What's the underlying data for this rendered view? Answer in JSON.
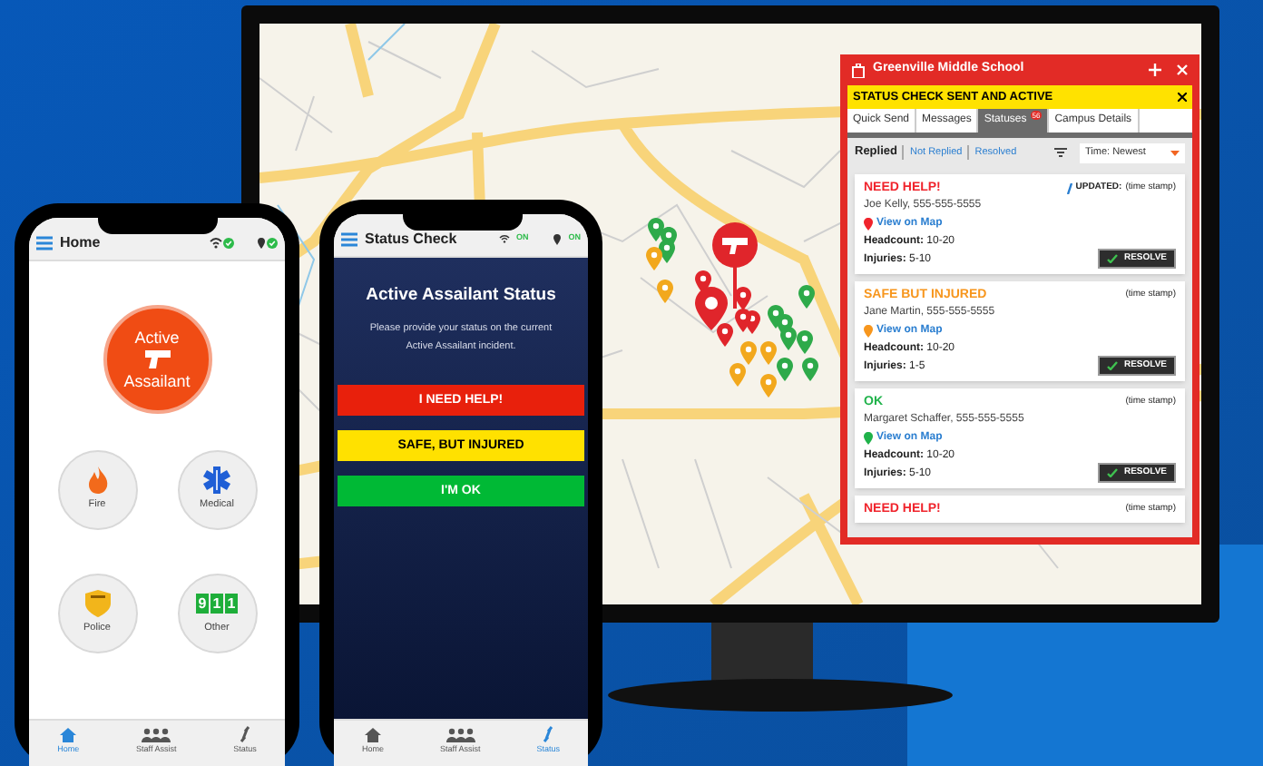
{
  "map": {
    "pins": [
      {
        "color": "#2eaa4a"
      },
      {
        "color": "#2eaa4a"
      },
      {
        "color": "#2eaa4a"
      },
      {
        "color": "#f2a81d"
      },
      {
        "color": "#f2a81d"
      },
      {
        "color": "#e0252b"
      },
      {
        "color": "#e0252b"
      },
      {
        "color": "#e0252b"
      },
      {
        "color": "#e0252b"
      },
      {
        "color": "#e0252b"
      },
      {
        "color": "#2eaa4a"
      },
      {
        "color": "#2eaa4a"
      },
      {
        "color": "#2eaa4a"
      },
      {
        "color": "#2eaa4a"
      },
      {
        "color": "#2eaa4a"
      },
      {
        "color": "#f2a81d"
      },
      {
        "color": "#f2a81d"
      },
      {
        "color": "#f2a81d"
      },
      {
        "color": "#2eaa4a"
      },
      {
        "color": "#2eaa4a"
      },
      {
        "color": "#f2a81d"
      }
    ]
  },
  "alert_window": {
    "title": "Greenville Middle School",
    "banner": "STATUS CHECK SENT AND ACTIVE",
    "tabs": [
      {
        "label": "Quick Send",
        "selected": false
      },
      {
        "label": "Messages",
        "selected": false
      },
      {
        "label": "Statuses",
        "selected": true,
        "badge": "56"
      },
      {
        "label": "Campus Details",
        "selected": false
      }
    ],
    "filters": [
      {
        "label": "Replied",
        "selected": true
      },
      {
        "label": "Not Replied",
        "selected": false
      },
      {
        "label": "Resolved",
        "selected": false
      }
    ],
    "sort": "Time: Newest",
    "statuses": [
      {
        "status": "NEED HELP!",
        "color": "#f0242c",
        "updated_label": "UPDATED:",
        "time": "(time stamp)",
        "name": "Joe Kelly, 555-555-5555",
        "map_link": "View on Map",
        "headcount_label": "Headcount:",
        "headcount": "10-20",
        "injuries_label": "Injuries:",
        "injuries": "5-10",
        "action": "RESOLVE"
      },
      {
        "status": "SAFE BUT INJURED",
        "color": "#f7961d",
        "time": "(time stamp)",
        "name": "Jane Martin, 555-555-5555",
        "map_link": "View on Map",
        "headcount_label": "Headcount:",
        "headcount": "10-20",
        "injuries_label": "Injuries:",
        "injuries": "1-5",
        "action": "RESOLVE"
      },
      {
        "status": "OK",
        "color": "#1fb24a",
        "time": "(time stamp)",
        "name": "Margaret Schaffer, 555-555-5555",
        "map_link": "View on Map",
        "headcount_label": "Headcount:",
        "headcount": "10-20",
        "injuries_label": "Injuries:",
        "injuries": "5-10",
        "action": "RESOLVE"
      },
      {
        "status": "NEED HELP!",
        "color": "#f0242c",
        "time": "(time stamp)"
      }
    ]
  },
  "home_phone": {
    "title": "Home",
    "emergency_button": {
      "line1": "Active",
      "line2": "Assailant"
    },
    "alert_buttons": [
      {
        "label": "Fire",
        "kind": "fire"
      },
      {
        "label": "Medical",
        "kind": "medical"
      },
      {
        "label": "Police",
        "kind": "police"
      },
      {
        "label": "Other",
        "kind": "other"
      }
    ],
    "other_icon_digits": [
      "9",
      "1",
      "1"
    ],
    "nav": [
      {
        "label": "Home",
        "selected": true
      },
      {
        "label": "Staff Assist",
        "selected": false
      },
      {
        "label": "Status",
        "selected": false
      }
    ]
  },
  "status_phone": {
    "title": "Status Check",
    "status_indicators": [
      "ON",
      "ON"
    ],
    "heading": "Active Assailant Status",
    "message": "Please provide your status on the current Active Assailant incident.",
    "options": [
      {
        "label": "I NEED HELP!",
        "color": "#e8200c"
      },
      {
        "label": "SAFE, BUT INJURED",
        "color": "#ffe100"
      },
      {
        "label": "I'M OK",
        "color": "#00b935"
      }
    ],
    "nav": [
      {
        "label": "Home",
        "selected": false
      },
      {
        "label": "Staff Assist",
        "selected": false
      },
      {
        "label": "Status",
        "selected": true
      }
    ]
  }
}
